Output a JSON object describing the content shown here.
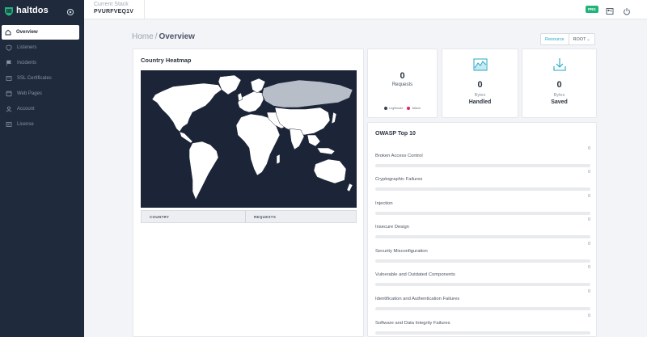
{
  "app": {
    "name": "haltdos"
  },
  "sidebar": {
    "items": [
      {
        "label": "Overview",
        "icon": "home-icon",
        "active": true
      },
      {
        "label": "Listeners",
        "icon": "shield-icon",
        "active": false
      },
      {
        "label": "Incidents",
        "icon": "flag-icon",
        "active": false
      },
      {
        "label": "SSL Certificates",
        "icon": "certificate-icon",
        "active": false
      },
      {
        "label": "Web Pages",
        "icon": "webpage-icon",
        "active": false
      },
      {
        "label": "Account",
        "icon": "user-icon",
        "active": false
      },
      {
        "label": "License",
        "icon": "license-icon",
        "active": false
      }
    ]
  },
  "topbar": {
    "stack_label": "Current Stack",
    "stack_value": "PVURFVEQ1V",
    "badge": "PRG"
  },
  "breadcrumb": {
    "home": "Home",
    "separator": "/",
    "current": "Overview"
  },
  "filters": {
    "resource": "Resource",
    "root": "ROOT"
  },
  "heatmap": {
    "title": "Country Heatmap",
    "columns": [
      "COUNTRY",
      "REQUESTS"
    ]
  },
  "stats": {
    "requests": {
      "value": "0",
      "label": "Requests",
      "legend": [
        "Legitimate",
        "Attack"
      ]
    },
    "handled": {
      "value": "0",
      "sub": "Bytes",
      "label": "Handled"
    },
    "saved": {
      "value": "0",
      "sub": "Bytes",
      "label": "Saved"
    }
  },
  "owasp": {
    "title": "OWASP Top 10",
    "items": [
      {
        "name": "Broken Access Control",
        "count": "0"
      },
      {
        "name": "Cryptographic Failures",
        "count": "0"
      },
      {
        "name": "Injection",
        "count": "0"
      },
      {
        "name": "Insecure Design",
        "count": "0"
      },
      {
        "name": "Security Misconfiguration",
        "count": "0"
      },
      {
        "name": "Vulnerable and Outdated Components",
        "count": "0"
      },
      {
        "name": "Identification and Authentication Failures",
        "count": "0"
      },
      {
        "name": "Software and Data Integrity Failures",
        "count": "0"
      }
    ]
  },
  "colors": {
    "sidebar_bg": "#1f2a3d",
    "accent": "#20a7c7",
    "badge": "#21b37a",
    "legit": "#3b4250",
    "attack": "#e0245e",
    "map_bg": "#1c2538",
    "map_land": "#ffffff",
    "map_highlight": "#b8bec8"
  }
}
